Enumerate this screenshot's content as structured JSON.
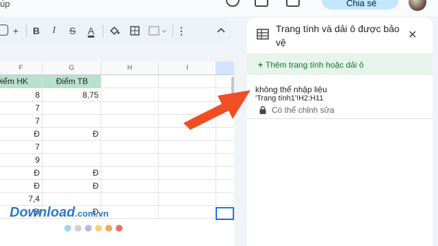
{
  "menu": {
    "fragment": "úp"
  },
  "header": {
    "share_label": "Chia sẻ"
  },
  "sheet": {
    "columns": [
      "F",
      "G",
      "H",
      "I"
    ],
    "header_row": [
      "Điểm HK",
      "Điểm TB",
      "",
      ""
    ],
    "rows": [
      [
        "8",
        "8,75"
      ],
      [
        "7",
        ""
      ],
      [
        "7",
        ""
      ],
      [
        "Đ",
        "Đ"
      ],
      [
        "7",
        ""
      ],
      [
        "9",
        ""
      ],
      [
        "Đ",
        "Đ"
      ],
      [
        "Đ",
        "Đ"
      ],
      [
        "7,4",
        ""
      ],
      [
        "Đ",
        "Đ"
      ]
    ]
  },
  "panel": {
    "title": "Trang tính và dải ô được bảo vệ",
    "add_label": "Thêm trang tính hoặc dải ô",
    "entry": {
      "description": "không thể nhập liệu",
      "range": "'Trang tính1'!H2:H11",
      "permission": "Có thể chỉnh sửa"
    }
  },
  "watermark": {
    "text": "Download",
    "suffix": ".com.vn",
    "dot_colors": [
      "#9fd5f0",
      "#d0d0d0",
      "#c6b2e8",
      "#f9d46b",
      "#f0a85a",
      "#f26b6b"
    ]
  },
  "colors": {
    "accent": "#1a73e8",
    "header_fill": "#b7e1cd",
    "add_green": "#137333",
    "arrow": "#f04e23"
  }
}
